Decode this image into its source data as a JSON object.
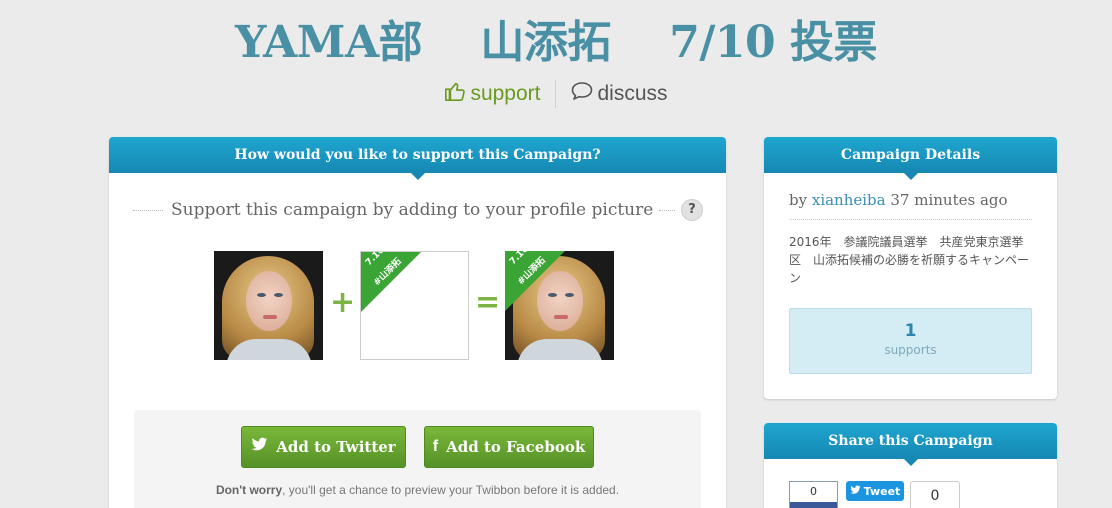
{
  "header": {
    "title": "YAMA部　 山添拓　 7/10 投票",
    "support_label": "support",
    "discuss_label": "discuss"
  },
  "support_panel": {
    "heading": "How would you like to support this Campaign?",
    "instruction": "Support this campaign by adding to your profile picture",
    "help_label": "?",
    "ribbon_line1": "7.10",
    "ribbon_line2": "#山添拓",
    "plus": "+",
    "equals": "=",
    "twitter_button": "Add to Twitter",
    "facebook_button": "Add to Facebook",
    "note_bold": "Don't worry",
    "note_rest": ", you'll get a chance to preview your Twibbon before it is added."
  },
  "details_panel": {
    "heading": "Campaign Details",
    "by_prefix": "by",
    "author": "xianheiba",
    "time_ago": "37 minutes ago",
    "description": "2016年　参議院議員選挙　共産党東京選挙区　山添拓候補の必勝を祈願するキャンペーン",
    "support_count": "1",
    "support_label": "supports"
  },
  "share_panel": {
    "heading": "Share this Campaign",
    "facebook_count": "0",
    "tweet_label": "Tweet",
    "google_count": "0"
  },
  "colors": {
    "title": "#4a90a4",
    "panel_header": "#1688b3",
    "button_green": "#559227",
    "ribbon_green": "#3aa535",
    "support_link": "#6a9a1f"
  }
}
